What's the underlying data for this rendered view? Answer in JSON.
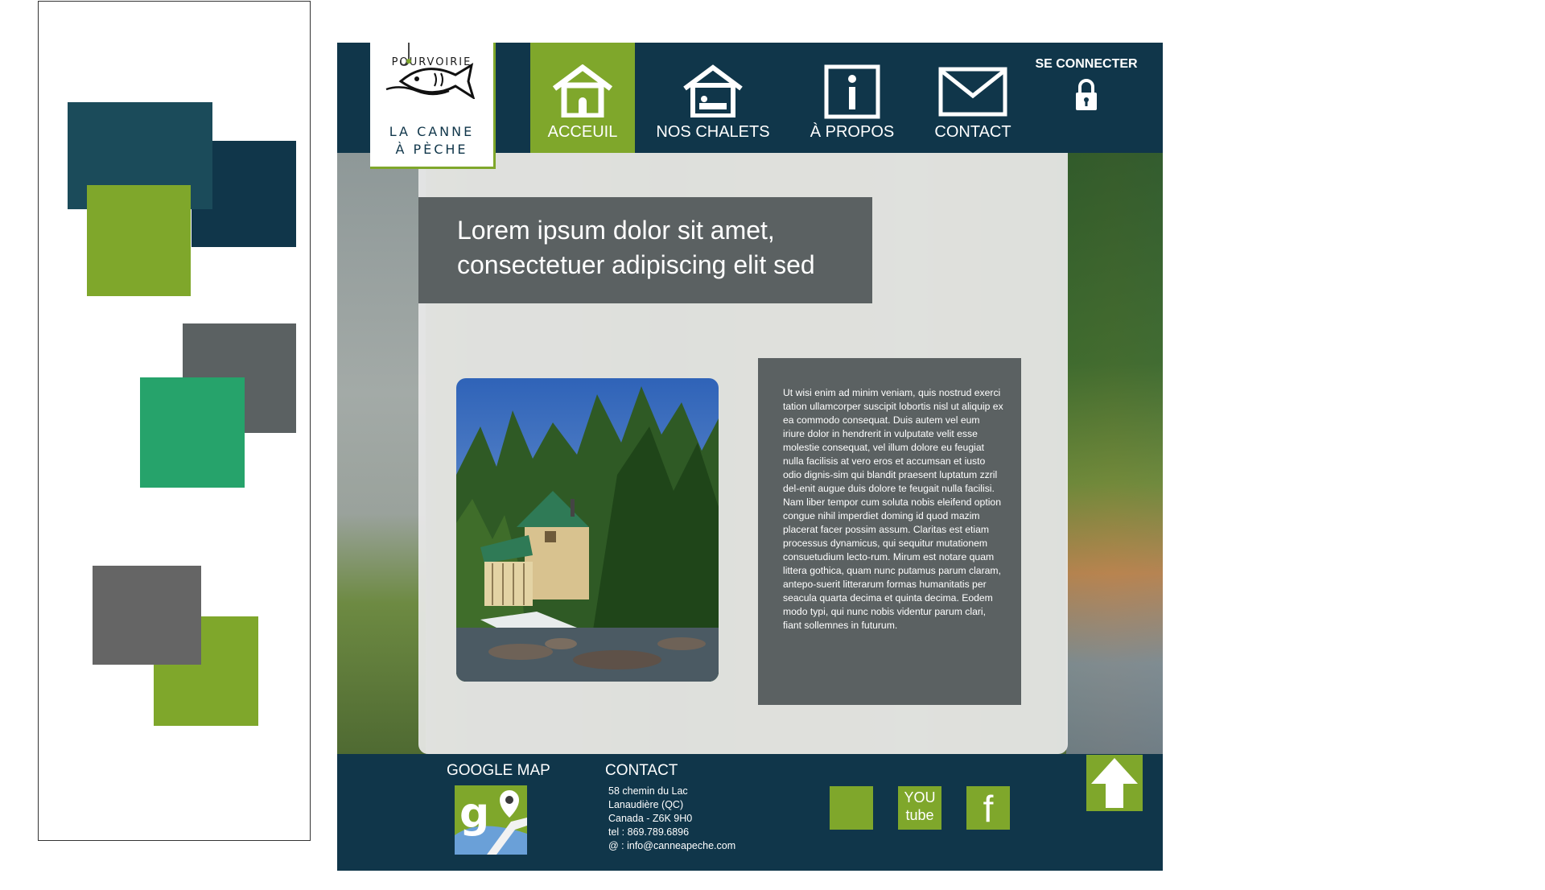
{
  "palette": {
    "colors": {
      "dark_teal": "#1b4b5a",
      "navy_teal": "#10364a",
      "lime_green": "#7fa72b",
      "slate_gray": "#5b6162",
      "emerald": "#26a36b",
      "mid_gray": "#656565"
    }
  },
  "logo": {
    "line1": "POURVOIRIE",
    "line2": "LA CANNE",
    "line3": "À PÈCHE"
  },
  "nav": {
    "items": [
      {
        "label": "ACCEUIL",
        "icon": "house-icon",
        "active": true
      },
      {
        "label": "NOS CHALETS",
        "icon": "cabin-bed-icon",
        "active": false
      },
      {
        "label": "À PROPOS",
        "icon": "info-icon",
        "active": false
      },
      {
        "label": "CONTACT",
        "icon": "envelope-icon",
        "active": false
      }
    ],
    "login_label": "SE CONNECTER",
    "login_icon": "lock-icon"
  },
  "main": {
    "title_line1": "Lorem ipsum dolor sit amet,",
    "title_line2": "consectetuer adipiscing elit sed",
    "body_text": "Ut wisi enim ad minim veniam, quis nostrud exerci tation ullamcorper suscipit lobortis nisl ut aliquip ex ea commodo consequat. Duis autem vel eum iriure dolor in hendrerit in vulputate velit esse molestie consequat, vel illum dolore eu feugiat nulla facilisis at vero eros et accumsan et iusto odio dignis-sim qui blandit praesent luptatum zzril del-enit augue duis dolore te feugait nulla facilisi. Nam liber tempor cum soluta nobis eleifend option congue nihil imperdiet doming id quod mazim placerat facer possim assum. Claritas est etiam processus dynamicus, qui sequitur mutationem consuetudium lecto-rum. Mirum est notare quam littera gothica, quam nunc putamus parum claram, antepo-suerit litterarum formas humanitatis per seacula quarta decima et quinta decima. Eodem modo typi, qui nunc nobis videntur parum clari, fiant sollemnes in futurum."
  },
  "footer": {
    "map_heading": "GOOGLE MAP",
    "contact_heading": "CONTACT",
    "address": [
      "58 chemin du Lac",
      "Lanaudière (QC)",
      "Canada - Z6K 9H0",
      "tel : 869.789.6896",
      "@ : info@canneapeche.com"
    ],
    "youtube_line1": "YOU",
    "youtube_line2": "tube",
    "facebook_letter": "f"
  }
}
